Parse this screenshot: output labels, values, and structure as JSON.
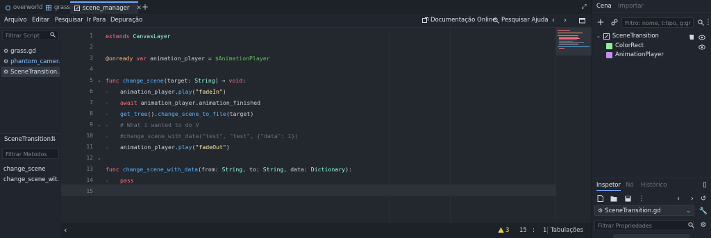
{
  "tabs": [
    {
      "label": "overworld",
      "icon": "scene-circle-icon"
    },
    {
      "label": "grass",
      "icon": "grass-scene-icon"
    },
    {
      "label": "scene_manager",
      "icon": "script-edit-icon",
      "active": true
    }
  ],
  "menu": {
    "items": [
      "Arquivo",
      "Editar",
      "Pesquisar",
      "Ir Para",
      "Depuração"
    ],
    "online_docs": "Documentação Online",
    "search_help": "Pesquisar Ajuda"
  },
  "left": {
    "filter_script_placeholder": "Filtrar Script",
    "scripts": [
      "grass.gd",
      "phantom_camer...",
      "SceneTransition..."
    ],
    "current_script": "SceneTransition.",
    "filter_methods_placeholder": "Filtrar Metodos",
    "methods": [
      "change_scene",
      "change_scene_wit..."
    ]
  },
  "editor": {
    "line_numbers": [
      "1",
      "2",
      "3",
      "4",
      "5",
      "6",
      "7",
      "8",
      "9",
      "10",
      "11",
      "12",
      "13",
      "14",
      "15"
    ]
  },
  "status": {
    "warnings": "3",
    "line": "15",
    "col": "1",
    "indent": "Tabulações"
  },
  "dock": {
    "tab_scene": "Cena",
    "tab_import": "Importar",
    "filter_placeholder": "Filtro: nome, t:tipo, g:gr",
    "nodes": [
      "SceneTransition",
      "ColorRect",
      "AnimationPlayer"
    ],
    "inspector_tabs": [
      "Inspetor",
      "Nó",
      "Histórico"
    ],
    "resource_name": "SceneTransition.gd",
    "filter_props_placeholder": "Filtrar Propriedades"
  },
  "colors": {
    "accent": "#6fa8ff",
    "keyword": "#ff7085",
    "type": "#8fffdb",
    "function": "#57b3ff",
    "string": "#ffeda1",
    "comment": "#6d727a",
    "annotation": "#ffb373",
    "node_path": "#63c259",
    "warning": "#ffdd65"
  }
}
